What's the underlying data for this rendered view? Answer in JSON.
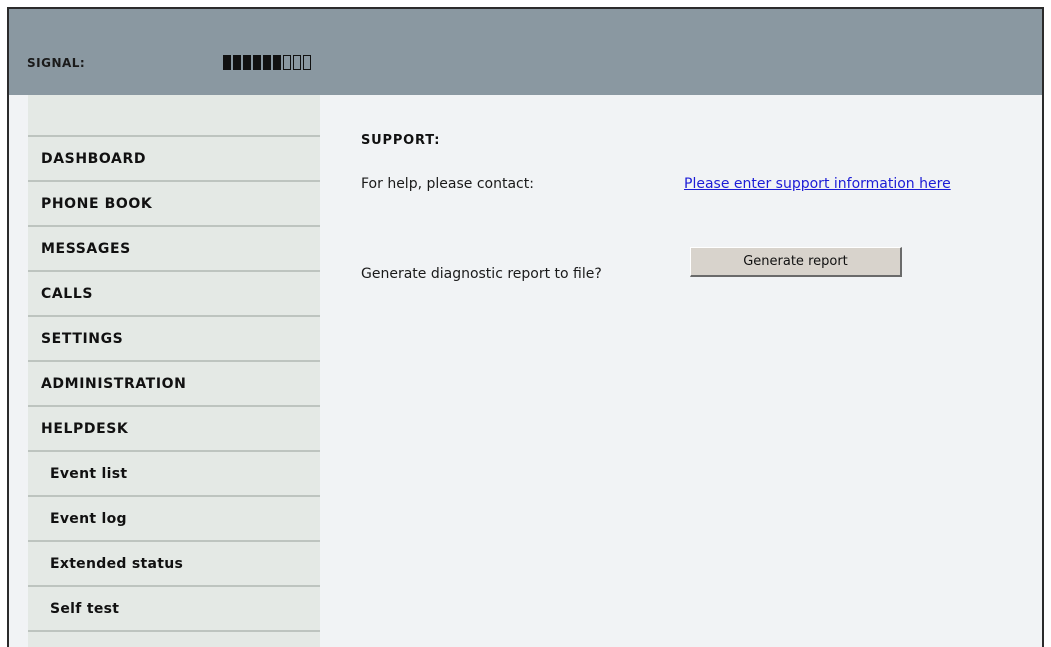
{
  "header": {
    "signal_label": "SIGNAL:",
    "signal_strength": {
      "filled": 6,
      "total": 9
    }
  },
  "sidebar": {
    "items": [
      {
        "label": "DASHBOARD",
        "name": "sidebar-item-dashboard",
        "sub": false
      },
      {
        "label": "PHONE BOOK",
        "name": "sidebar-item-phone-book",
        "sub": false
      },
      {
        "label": "MESSAGES",
        "name": "sidebar-item-messages",
        "sub": false
      },
      {
        "label": "CALLS",
        "name": "sidebar-item-calls",
        "sub": false
      },
      {
        "label": "SETTINGS",
        "name": "sidebar-item-settings",
        "sub": false
      },
      {
        "label": "ADMINISTRATION",
        "name": "sidebar-item-administration",
        "sub": false
      },
      {
        "label": "HELPDESK",
        "name": "sidebar-item-helpdesk",
        "sub": false
      },
      {
        "label": "Event list",
        "name": "sidebar-subitem-event-list",
        "sub": true
      },
      {
        "label": "Event log",
        "name": "sidebar-subitem-event-log",
        "sub": true
      },
      {
        "label": "Extended status",
        "name": "sidebar-subitem-extended-status",
        "sub": true
      },
      {
        "label": "Self test",
        "name": "sidebar-subitem-self-test",
        "sub": true
      }
    ]
  },
  "main": {
    "section_title": "SUPPORT:",
    "help_label": "For help, please contact:",
    "help_link": "Please enter support information here",
    "diagnostic_label": "Generate diagnostic report to file?",
    "generate_button": "Generate report"
  },
  "colors": {
    "header_bg": "#8a98a1",
    "sidebar_bg": "#e4e9e5",
    "content_bg": "#f1f3f5",
    "link": "#1c1cd6"
  }
}
